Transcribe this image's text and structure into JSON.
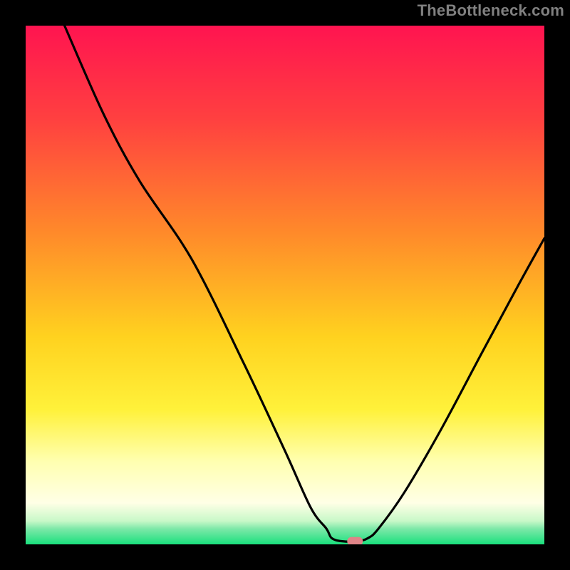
{
  "watermark": "TheBottleneck.com",
  "chart_data": {
    "type": "line",
    "title": "",
    "xlabel": "",
    "ylabel": "",
    "xlim": [
      0,
      100
    ],
    "ylim": [
      0,
      100
    ],
    "has_grid": false,
    "legend": false,
    "annotations": [],
    "background": {
      "type": "vertical-gradient",
      "description": "Red at top through orange, yellow, pale yellow, to thin green band at bottom",
      "stops": [
        {
          "offset": 0,
          "color": "#ff1450"
        },
        {
          "offset": 18,
          "color": "#ff4040"
        },
        {
          "offset": 40,
          "color": "#ff8a2a"
        },
        {
          "offset": 60,
          "color": "#ffd21f"
        },
        {
          "offset": 74,
          "color": "#fff13a"
        },
        {
          "offset": 84,
          "color": "#ffffb0"
        },
        {
          "offset": 92,
          "color": "#ffffe6"
        },
        {
          "offset": 95.5,
          "color": "#c8f8c8"
        },
        {
          "offset": 97,
          "color": "#7de8a8"
        },
        {
          "offset": 100,
          "color": "#1ae07d"
        }
      ]
    },
    "series": [
      {
        "name": "bottleneck-curve",
        "color": "#000000",
        "description": "V-shaped curve descending from upper-left, flattening at minimum, then rising to upper-right",
        "points": [
          {
            "x": 7.5,
            "y": 100
          },
          {
            "x": 15,
            "y": 83
          },
          {
            "x": 22,
            "y": 70
          },
          {
            "x": 32,
            "y": 55
          },
          {
            "x": 42,
            "y": 35
          },
          {
            "x": 50,
            "y": 18
          },
          {
            "x": 55,
            "y": 7
          },
          {
            "x": 58,
            "y": 3
          },
          {
            "x": 59,
            "y": 1.2
          },
          {
            "x": 61,
            "y": 0.6
          },
          {
            "x": 64,
            "y": 0.6
          },
          {
            "x": 66,
            "y": 1.2
          },
          {
            "x": 68,
            "y": 3
          },
          {
            "x": 73,
            "y": 10
          },
          {
            "x": 80,
            "y": 22
          },
          {
            "x": 88,
            "y": 37
          },
          {
            "x": 95,
            "y": 50
          },
          {
            "x": 100,
            "y": 59
          }
        ]
      }
    ],
    "marker": {
      "description": "Small pale-red rounded marker at curve minimum",
      "x": 63.5,
      "y": 0.6,
      "color": "#e08488"
    },
    "frame": {
      "description": "Thick black border around plot area",
      "color": "#000000"
    }
  }
}
